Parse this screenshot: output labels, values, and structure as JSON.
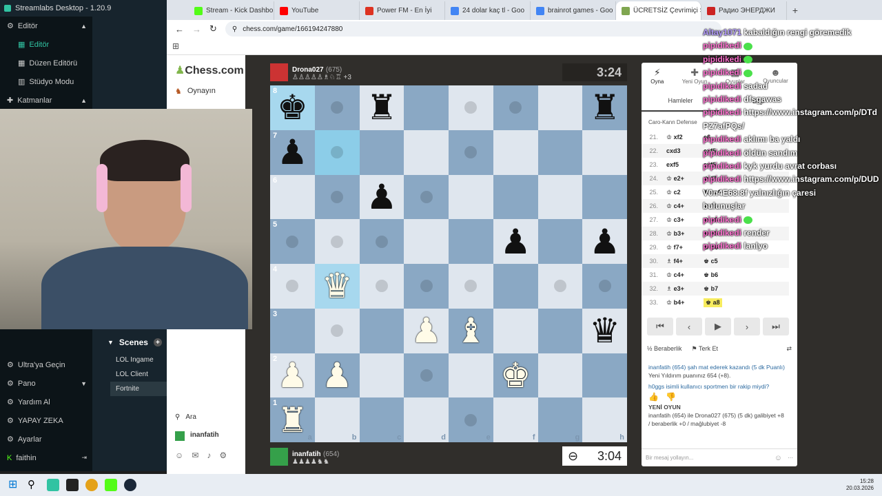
{
  "streamlabs": {
    "title": "Streamlabs Desktop - 1.20.9",
    "menu": [
      {
        "label": "Editör"
      },
      {
        "label": "Editör"
      },
      {
        "label": "Düzen Editörü"
      },
      {
        "label": "Stüdyo Modu"
      },
      {
        "label": "Katmanlar"
      }
    ],
    "bottom_menu": [
      {
        "label": "Ultra'ya Geçin"
      },
      {
        "label": "Pano"
      },
      {
        "label": "Yardım Al"
      },
      {
        "label": "YAPAY ZEKA"
      },
      {
        "label": "Ayarlar"
      },
      {
        "label": "faithin"
      }
    ],
    "scenes_title": "Scenes",
    "scenes": [
      "LOL Ingame",
      "LOL Client",
      "Fortnite"
    ]
  },
  "browser": {
    "tabs": [
      {
        "label": "Stream - Kick Dashbo",
        "color": "#53fc18"
      },
      {
        "label": "YouTube",
        "color": "#ff0000"
      },
      {
        "label": "Power FM - En İyi",
        "color": "#d32"
      },
      {
        "label": "24 dolar kaç tl - Goo",
        "color": "#4285f4"
      },
      {
        "label": "brainrot games - Goo",
        "color": "#4285f4"
      },
      {
        "label": "ÜCRETSİZ Çevrimiçi S",
        "color": "#7fa650"
      },
      {
        "label": "Радио ЭНЕРДЖИ",
        "color": "#c22"
      }
    ],
    "url": "chess.com/game/166194247880"
  },
  "chesscom": {
    "logo": "Chess.com",
    "nav_play": "Oynayın",
    "search": "Ara",
    "user": "inanfatih"
  },
  "game": {
    "top_player": {
      "name": "Drona027",
      "rating": "(675)",
      "captured_extra": "+3"
    },
    "bottom_player": {
      "name": "inanfatih",
      "rating": "(654)"
    },
    "top_clock": "3:24",
    "bottom_clock": "3:04",
    "opening": "Caro-Kann Defense",
    "board": [
      [
        "bk",
        "dot",
        "br",
        "",
        "dot",
        "dot",
        "",
        "br"
      ],
      [
        "bp",
        "dot",
        "",
        "",
        "dot",
        "",
        "",
        ""
      ],
      [
        "",
        "dot",
        "bp",
        "dot",
        "",
        "",
        "",
        ""
      ],
      [
        "dot",
        "dot",
        "dot",
        "",
        "",
        "bp",
        "",
        "bp"
      ],
      [
        "dot",
        "wq",
        "dot",
        "dot",
        "dot",
        "",
        "dot",
        "dot"
      ],
      [
        "",
        "dot",
        "",
        "wp",
        "wb",
        "",
        "",
        "bq"
      ],
      [
        "wp",
        "wp",
        "",
        "dot",
        "",
        "wk",
        "",
        ""
      ],
      [
        "wr",
        "",
        "",
        "",
        "dot",
        "",
        "",
        ""
      ]
    ],
    "files": [
      "a",
      "b",
      "c",
      "d",
      "e",
      "f",
      "g",
      "h"
    ],
    "ranks": [
      "8",
      "7",
      "6",
      "5",
      "4",
      "3",
      "2",
      "1"
    ]
  },
  "panel": {
    "tabs": [
      "Oyna",
      "Yeni Oyun",
      "Oyunlar",
      "Oyuncular"
    ],
    "subtabs": [
      "Hamleler",
      "Bilgi"
    ],
    "moves": [
      {
        "n": "21.",
        "w": "♔ xf2",
        "b": "e6"
      },
      {
        "n": "22.",
        "w": "cxd3",
        "b": "exf5"
      },
      {
        "n": "23.",
        "w": "exf5",
        "b": "exf5"
      },
      {
        "n": "24.",
        "w": "♔ e2+",
        "b": "♚ f7"
      },
      {
        "n": "25.",
        "w": "♔ c2",
        "b": "♜ ac8"
      },
      {
        "n": "26.",
        "w": "♔ c4+",
        "b": "♚ f6"
      },
      {
        "n": "27.",
        "w": "♔ c3+",
        "b": "♚ e6"
      },
      {
        "n": "28.",
        "w": "♔ b3+",
        "b": "♚ e5"
      },
      {
        "n": "29.",
        "w": "♔ f7+",
        "b": "♚ d6"
      },
      {
        "n": "30.",
        "w": "♗ f4+",
        "b": "♚ c5"
      },
      {
        "n": "31.",
        "w": "♔ c4+",
        "b": "♚ b6"
      },
      {
        "n": "32.",
        "w": "♗ e3+",
        "b": "♚ b7"
      },
      {
        "n": "33.",
        "w": "♔ b4+",
        "b": "♚ a8"
      }
    ],
    "draw": "Beraberlik",
    "resign": "Terk Et",
    "log": [
      "inanfatih (654) şah mat ederek kazandı (5 dk Puanlı)",
      "Yeni Yıldırım puanınız 654 (+8).",
      "h0ggs isimli kullanıcı sportmen bir rakip miydi?",
      "YENİ OYUN",
      "inanfatih (654) ile Drona027 (675) (5 dk) galibiyet +8 / beraberlik +0 / mağlubiyet -8"
    ],
    "chat_placeholder": "Bir mesaj yollayın..."
  },
  "chat_overlay": [
    {
      "name": "Altay1071",
      "msg": "kabaldığın rengi göremedik"
    },
    {
      "name": "pipidikedi",
      "msg": ""
    },
    {
      "name": "pipidikedi",
      "msg": ""
    },
    {
      "name": "pipidikedi",
      "msg": ""
    },
    {
      "name": "pipidikedi",
      "msg": "sadad"
    },
    {
      "name": "pipidikedi",
      "msg": "dfsgawas"
    },
    {
      "name": "pipidikedi",
      "msg": "https://www.instagram.com/p/DTd"
    },
    {
      "name": "",
      "msg": "PZ7afPQs/"
    },
    {
      "name": "pipidikedi",
      "msg": "aklımı ba yaldı"
    },
    {
      "name": "pipidikedi",
      "msg": "öldün sandım"
    },
    {
      "name": "pipidikedi",
      "msg": "kyk yurdu avrat corbası"
    },
    {
      "name": "pipidikedi",
      "msg": "https://www.instagram.com/p/DUD"
    },
    {
      "name": "",
      "msg": "V0n4E68:8f yalnızlığın çaresi"
    },
    {
      "name": "",
      "msg": "bulunuşlar"
    },
    {
      "name": "pipidikedi",
      "msg": ""
    },
    {
      "name": "pipidikedi",
      "msg": "render"
    },
    {
      "name": "pipidikedi",
      "msg": "lanlyo"
    }
  ],
  "taskbar": {
    "time": "15:28",
    "date": "20.03.2026"
  }
}
